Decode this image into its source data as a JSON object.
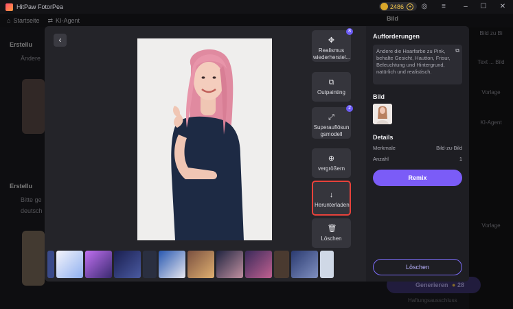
{
  "app": {
    "title": "HitPaw FotorPea"
  },
  "titlebar": {
    "credits": "2486"
  },
  "tabs": {
    "home": "Startseite",
    "agent": "KI-Agent"
  },
  "background": {
    "left_text_1": "Erstellu",
    "left_text_2": "Ändere",
    "left_text_3": "Erstellu",
    "left_text_4": "Bitte ge",
    "left_text_5": "deutsch",
    "right_items": [
      "Bild zu Bi",
      "Text ... Bild",
      "Vorlage",
      "KI-Agent",
      "Vorlage"
    ],
    "right_header": "Bild",
    "generate_label": "Generieren",
    "generate_cost": "28",
    "help_label": "Haftungsausschluss"
  },
  "modal": {
    "tools": [
      {
        "label": "Realismus wiederherstel...",
        "badge": "8",
        "icon": "crosshair-icon"
      },
      {
        "label": "Outpainting",
        "badge": "",
        "icon": "expand-image-icon"
      },
      {
        "label": "Superauflösun gsmodell",
        "badge": "2",
        "icon": "resize-icon"
      },
      {
        "label": "vergrößern",
        "badge": "",
        "icon": "zoom-in-icon"
      },
      {
        "label": "Herunterladen",
        "badge": "",
        "icon": "download-icon"
      },
      {
        "label": "Löschen",
        "badge": "",
        "icon": "trash-icon"
      }
    ],
    "panel": {
      "prompts_title": "Aufforderungen",
      "prompt_text": "Ändere die Haarfarbe zu Pink, behalte Gesicht, Hautton, Frisur, Beleuchtung und Hintergrund, natürlich und realistisch.",
      "image_title": "Bild",
      "details_title": "Details",
      "details": [
        {
          "key": "Merkmale",
          "value": "Bild-zu-Bild"
        },
        {
          "key": "Anzahl",
          "value": "1"
        }
      ],
      "remix_label": "Remix",
      "delete_label": "Löschen"
    },
    "thumbnails": [
      "#3a4a8a",
      "#f3f3fa",
      "#a05ce0",
      "#2f2a6e",
      "#1e2b5a",
      "#3a2c30",
      "#2a4a8f",
      "#5c3b2a",
      "#7b4a3a",
      "#1b1e3a",
      "#3c2e5a",
      "#202020",
      "#2b3f6a",
      "#4a4a55",
      "#cfd8e6"
    ]
  },
  "colors": {
    "accent": "#7b5cf7",
    "selected_outline": "#e8423b"
  }
}
